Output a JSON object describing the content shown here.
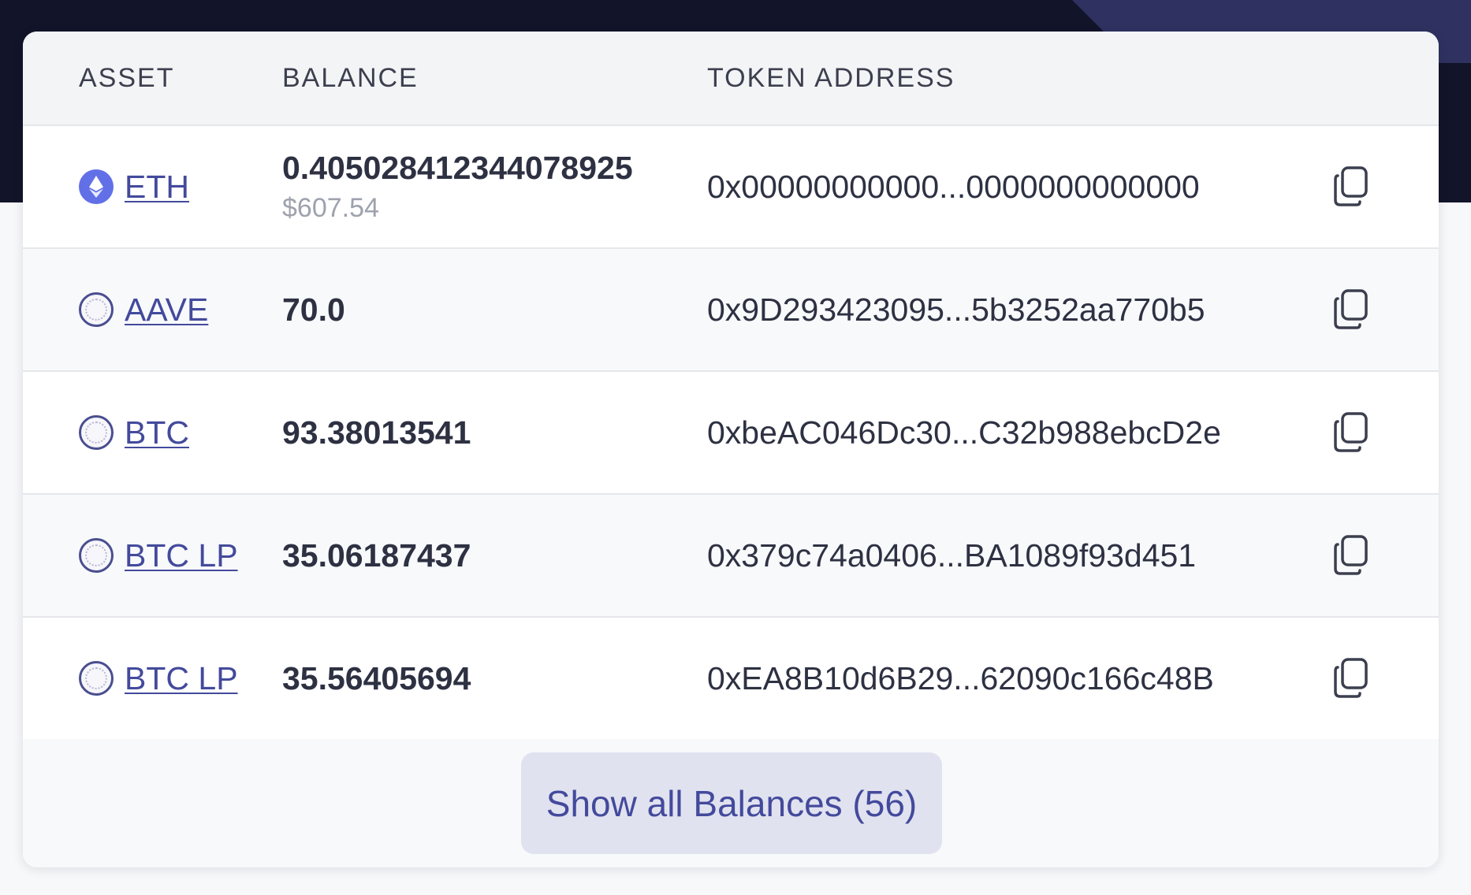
{
  "table": {
    "headers": {
      "asset": "ASSET",
      "balance": "BALANCE",
      "token_address": "TOKEN ADDRESS"
    },
    "rows": [
      {
        "asset": "ETH",
        "icon": "eth-icon",
        "balance": "0.405028412344078925",
        "usd": "$607.54",
        "address": "0x00000000000...0000000000000"
      },
      {
        "asset": "AAVE",
        "icon": "token-placeholder-icon",
        "balance": "70.0",
        "address": "0x9D293423095...5b3252aa770b5"
      },
      {
        "asset": "BTC",
        "icon": "token-placeholder-icon",
        "balance": "93.38013541",
        "address": "0xbeAC046Dc30...C32b988ebcD2e"
      },
      {
        "asset": "BTC LP",
        "icon": "token-placeholder-icon",
        "balance": "35.06187437",
        "address": "0x379c74a0406...BA1089f93d451"
      },
      {
        "asset": "BTC LP",
        "icon": "token-placeholder-icon",
        "balance": "35.56405694",
        "address": "0xEA8B10d6B29...62090c166c48B"
      }
    ]
  },
  "footer": {
    "show_all_label": "Show all Balances (56)"
  },
  "colors": {
    "hero_bg": "#121429",
    "link": "#434a9c",
    "eth_icon": "#6270e8",
    "button_bg": "#e1e2ef"
  }
}
